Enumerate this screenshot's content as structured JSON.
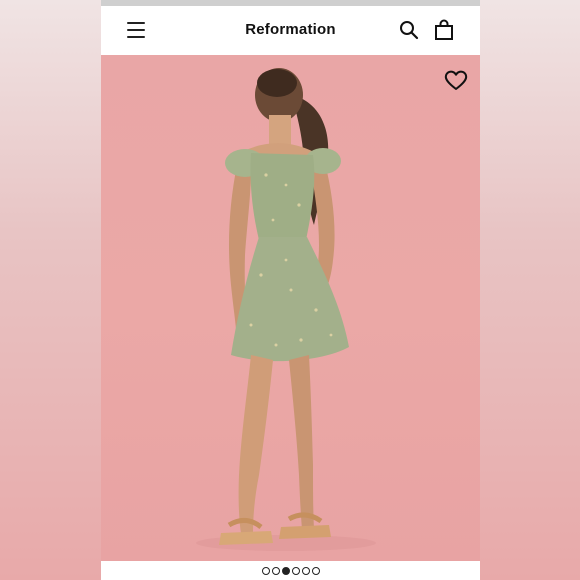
{
  "header": {
    "brand": "Reformation",
    "icons": [
      "menu-icon",
      "search-icon",
      "bag-icon"
    ]
  },
  "product_image": {
    "favorite_icon": "heart-icon"
  },
  "carousel": {
    "total": 6,
    "active_index": 2
  },
  "colors": {
    "background_pink": "#eba8a6",
    "text": "#111111",
    "dress_sage": "#9fae86"
  }
}
